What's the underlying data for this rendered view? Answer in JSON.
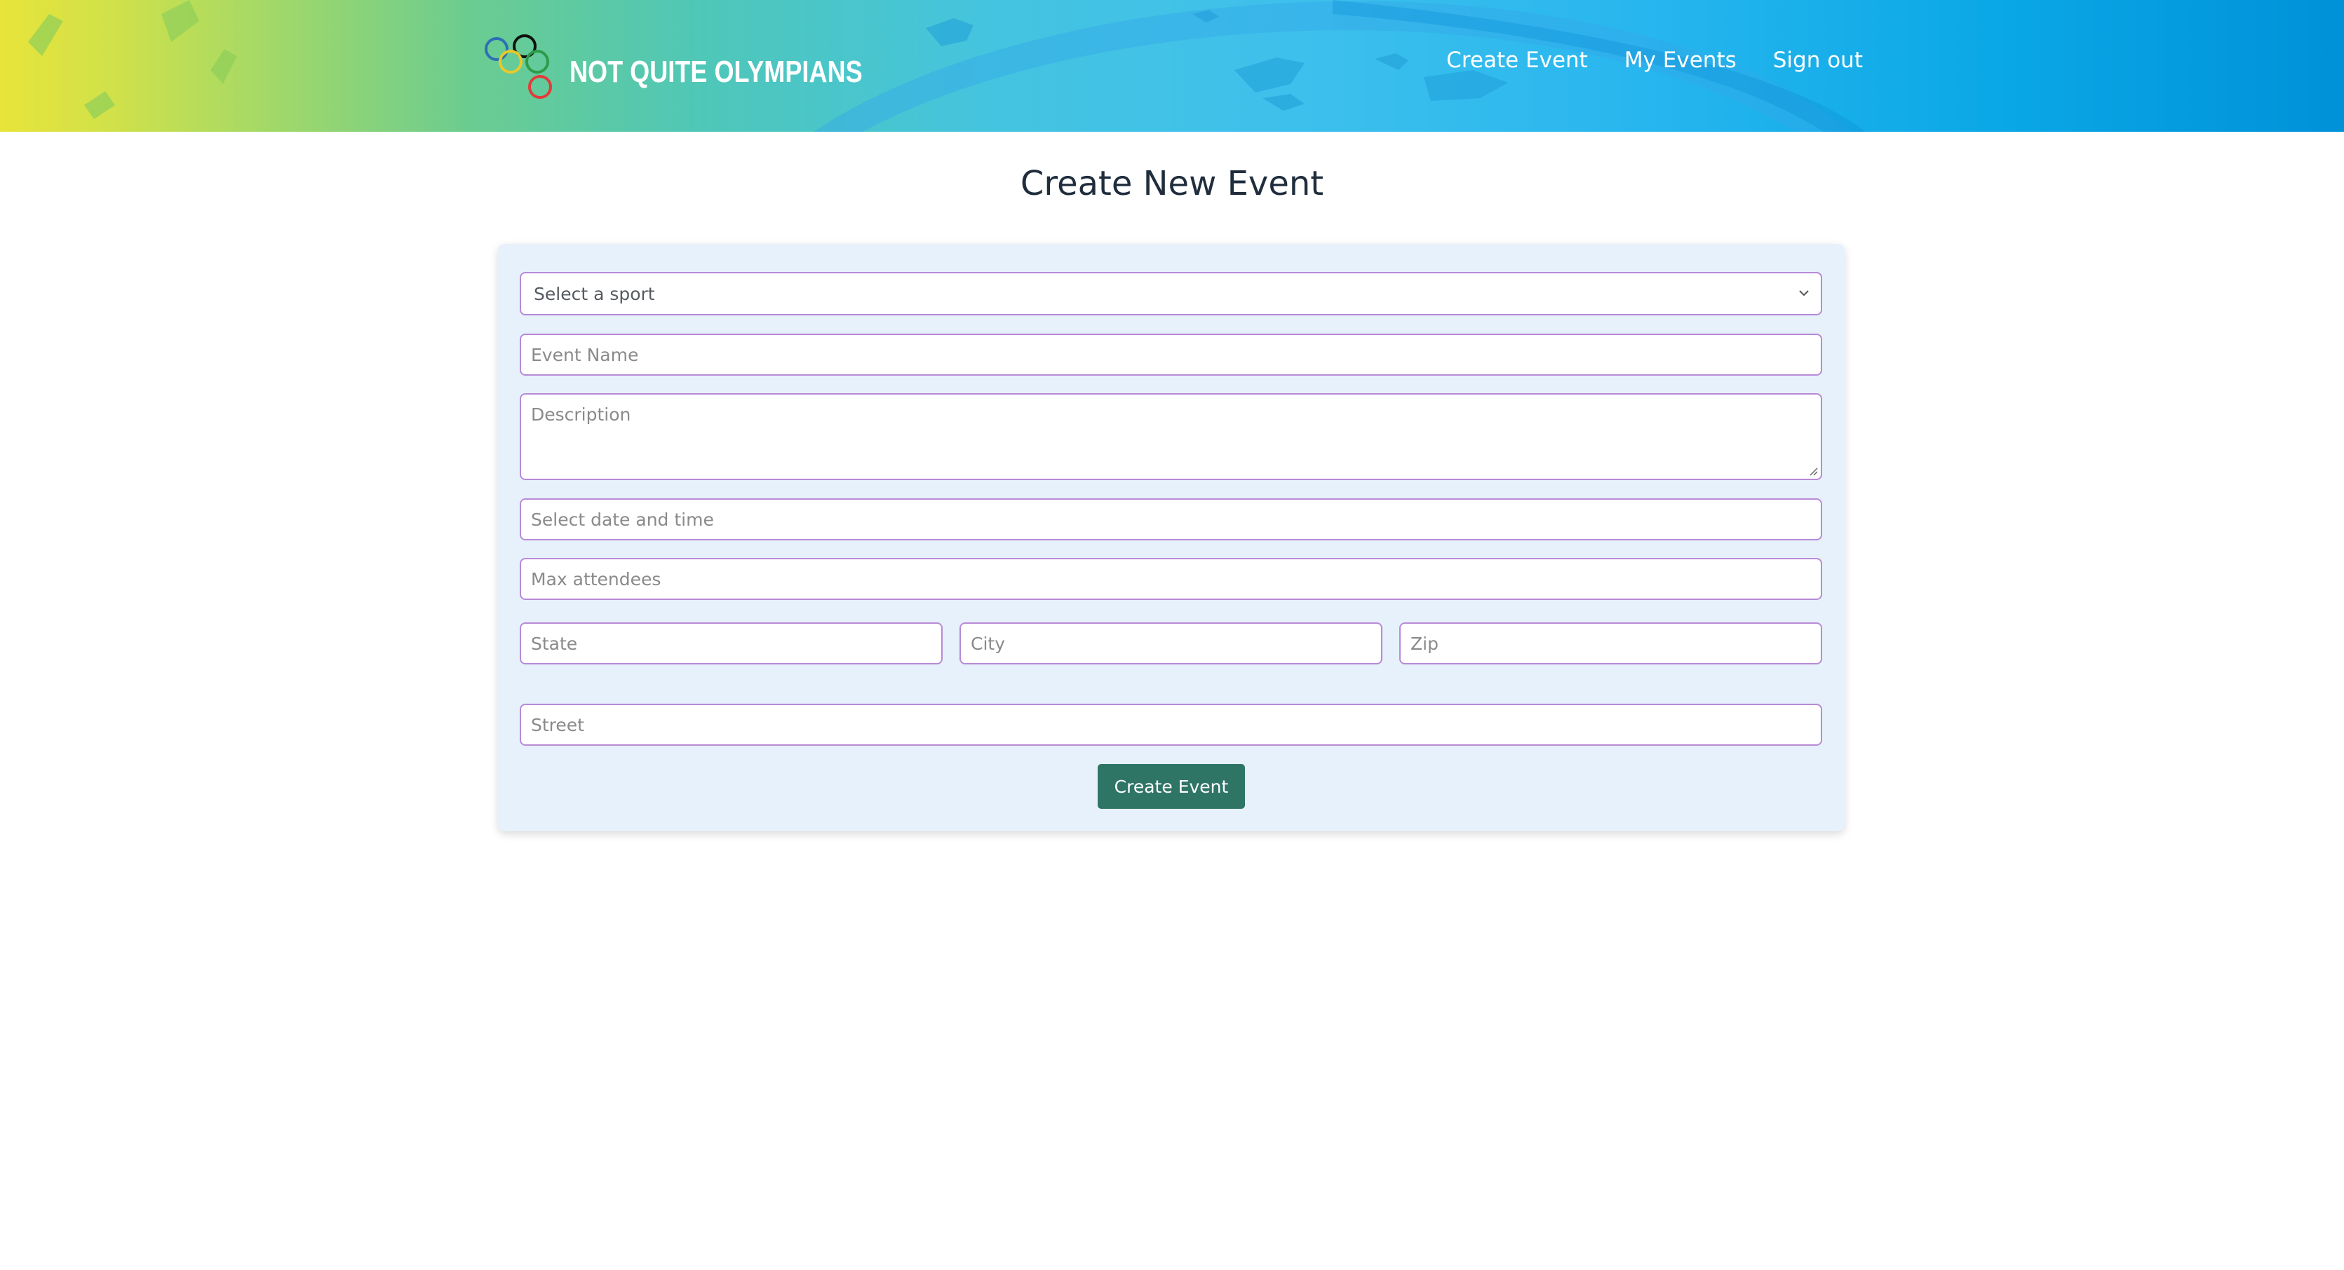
{
  "header": {
    "brand": "NOT QUITE OLYMPIANS",
    "nav": [
      {
        "label": "Create Event"
      },
      {
        "label": "My Events"
      },
      {
        "label": "Sign out"
      }
    ]
  },
  "page": {
    "title": "Create New Event"
  },
  "form": {
    "sport_select": {
      "value": "Select a sport"
    },
    "event_name": {
      "placeholder": "Event Name",
      "value": ""
    },
    "description": {
      "placeholder": "Description",
      "value": ""
    },
    "datetime": {
      "placeholder": "Select date and time",
      "value": ""
    },
    "max_attendees": {
      "placeholder": "Max attendees",
      "value": ""
    },
    "state": {
      "placeholder": "State",
      "value": ""
    },
    "city": {
      "placeholder": "City",
      "value": ""
    },
    "zip": {
      "placeholder": "Zip",
      "value": ""
    },
    "street": {
      "placeholder": "Street",
      "value": ""
    },
    "submit_label": "Create Event"
  },
  "colors": {
    "field_border": "#b88ad6",
    "card_bg": "#e7f1fb",
    "button_bg": "#2f7566",
    "title_text": "#1f2d3d"
  },
  "icons": {
    "logo": "olympic-rings-icon",
    "select": "chevron-down-icon",
    "textarea": "resize-grip-icon"
  }
}
